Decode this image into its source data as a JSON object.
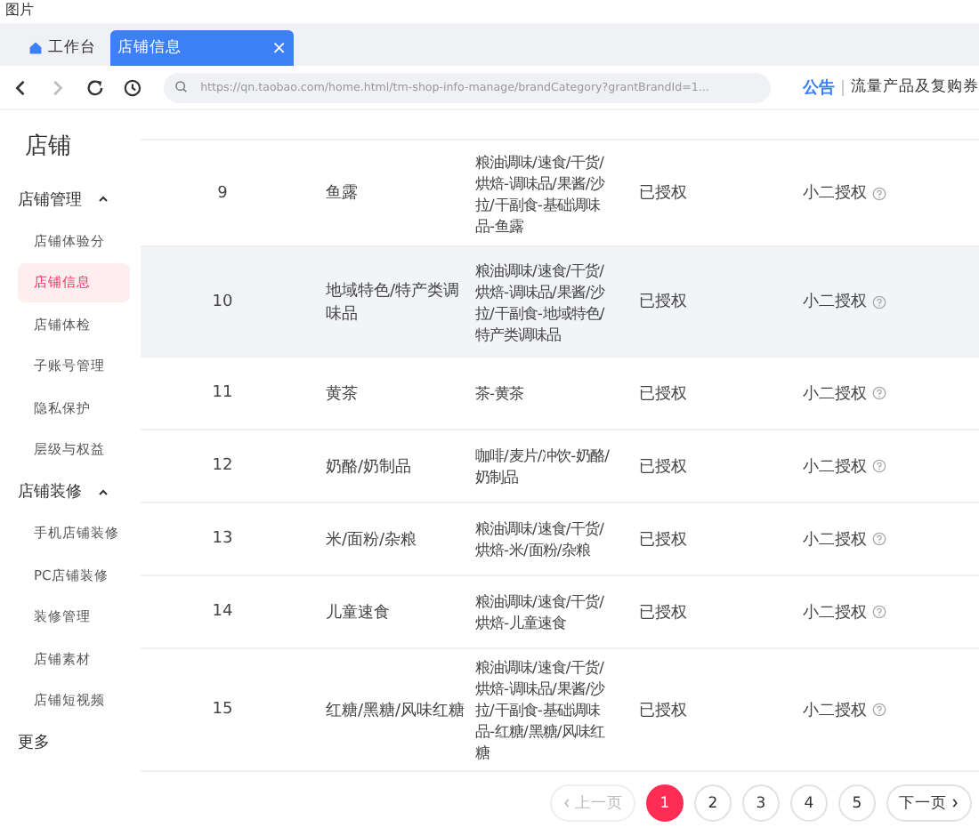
{
  "caption": "图片",
  "tabs": [
    {
      "label": "工作台",
      "selected": false,
      "closable": false
    },
    {
      "label": "店铺信息",
      "selected": true,
      "closable": true
    }
  ],
  "close_glyph": "×",
  "address_bar": {
    "url": "https://qn.taobao.com/home.html/tm-shop-info-manage/brandCategory?grantBrandId=1...",
    "notice_label": "公告",
    "notice_text": "流量产品及复购券"
  },
  "sidebar": {
    "title": "店铺",
    "groups": [
      {
        "label": "店铺管理",
        "expanded": true,
        "items": [
          {
            "label": "店铺体验分",
            "selected": false
          },
          {
            "label": "店铺信息",
            "selected": true
          },
          {
            "label": "店铺体检",
            "selected": false
          },
          {
            "label": "子账号管理",
            "selected": false
          },
          {
            "label": "隐私保护",
            "selected": false
          },
          {
            "label": "层级与权益",
            "selected": false
          }
        ]
      },
      {
        "label": "店铺装修",
        "expanded": true,
        "items": [
          {
            "label": "手机店铺装修",
            "selected": false
          },
          {
            "label": "PC店铺装修",
            "selected": false
          },
          {
            "label": "装修管理",
            "selected": false
          },
          {
            "label": "店铺素材",
            "selected": false
          },
          {
            "label": "店铺短视频",
            "selected": false
          }
        ]
      }
    ],
    "more": "更多"
  },
  "table": {
    "rows": [
      {
        "index": "9",
        "brand": "鱼露",
        "category": "粮油调味/速食/干货/烘焙-调味品/果酱/沙拉/干副食-基础调味品-鱼露",
        "status": "已授权",
        "auth": "小二授权",
        "highlighted": false
      },
      {
        "index": "10",
        "brand": "地域特色/特产类调味品",
        "category": "粮油调味/速食/干货/烘焙-调味品/果酱/沙拉/干副食-地域特色/特产类调味品",
        "status": "已授权",
        "auth": "小二授权",
        "highlighted": true
      },
      {
        "index": "11",
        "brand": "黄茶",
        "category": "茶-黄茶",
        "status": "已授权",
        "auth": "小二授权",
        "highlighted": false
      },
      {
        "index": "12",
        "brand": "奶酪/奶制品",
        "category": "咖啡/麦片/冲饮-奶酪/奶制品",
        "status": "已授权",
        "auth": "小二授权",
        "highlighted": false
      },
      {
        "index": "13",
        "brand": "米/面粉/杂粮",
        "category": "粮油调味/速食/干货/烘焙-米/面粉/杂粮",
        "status": "已授权",
        "auth": "小二授权",
        "highlighted": false
      },
      {
        "index": "14",
        "brand": "儿童速食",
        "category": "粮油调味/速食/干货/烘焙-儿童速食",
        "status": "已授权",
        "auth": "小二授权",
        "highlighted": false
      },
      {
        "index": "15",
        "brand": "红糖/黑糖/风味红糖",
        "category": "粮油调味/速食/干货/烘焙-调味品/果酱/沙拉/干副食-基础调味品-红糖/黑糖/风味红糖",
        "status": "已授权",
        "auth": "小二授权",
        "highlighted": false
      }
    ]
  },
  "pagination": {
    "prev": {
      "label": "上一页",
      "disabled": true
    },
    "pages": [
      {
        "label": "1",
        "selected": true
      },
      {
        "label": "2",
        "selected": false
      },
      {
        "label": "3",
        "selected": false
      },
      {
        "label": "4",
        "selected": false
      },
      {
        "label": "5",
        "selected": false
      }
    ],
    "next": {
      "label": "下一页",
      "disabled": false
    }
  }
}
